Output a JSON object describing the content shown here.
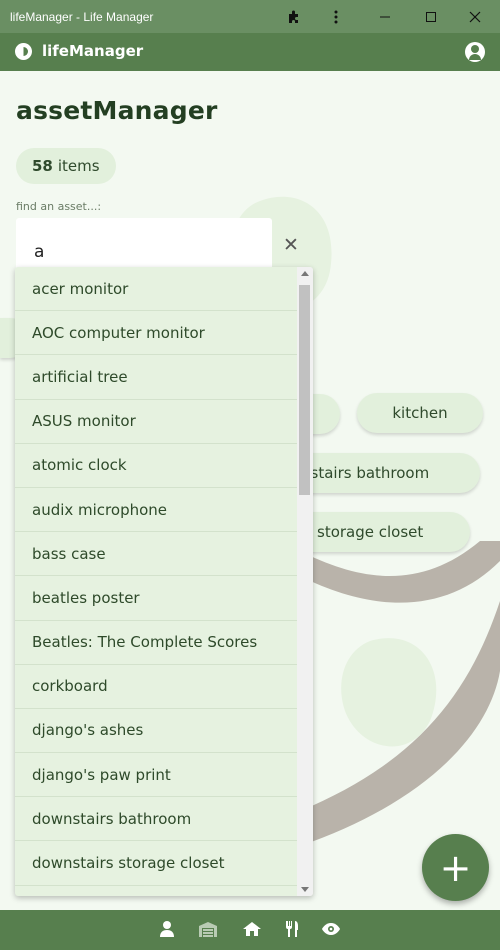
{
  "window": {
    "title": "lifeManager - Life Manager"
  },
  "header": {
    "brand": "lifeManager"
  },
  "main": {
    "page_title": "assetManager",
    "count_value": "58",
    "count_unit": "items",
    "search_label": "find an asset...:",
    "search_value": "a",
    "clear_symbol": "✕"
  },
  "rooms": [
    {
      "label": "kitchen"
    },
    {
      "label": "nstairs bathroom"
    },
    {
      "label": "storage closet"
    }
  ],
  "dropdown": {
    "items": [
      "acer monitor",
      "AOC computer monitor",
      "artificial tree",
      "ASUS monitor",
      "atomic clock",
      "audix microphone",
      "bass case",
      "beatles poster",
      "Beatles: The Complete Scores",
      "corkboard",
      "django's ashes",
      "django's paw print",
      "downstairs bathroom",
      "downstairs storage closet"
    ]
  },
  "fab": {
    "symbol": "+"
  },
  "icons": {
    "logo": "yin-yang-logo-icon",
    "account": "account-circle-icon",
    "extensions": "puzzle-icon",
    "nav": [
      "person-icon",
      "warehouse-icon",
      "home-icon",
      "utensils-icon",
      "eye-icon"
    ]
  },
  "colors": {
    "primary": "#577f4e",
    "window_bar": "#6a8f63",
    "background": "#f3f9f1",
    "chip": "#e2f0dc",
    "title": "#233f22"
  }
}
